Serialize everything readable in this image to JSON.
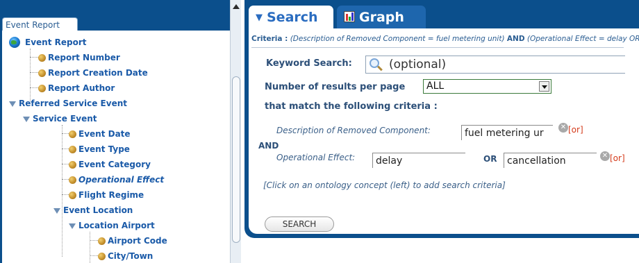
{
  "tree": {
    "tab_label": "Event Report",
    "items": [
      {
        "label": "Event Report",
        "type": "globe",
        "depth": 0
      },
      {
        "label": "Report Number",
        "type": "leaf",
        "depth": 1
      },
      {
        "label": "Report Creation Date",
        "type": "leaf",
        "depth": 1
      },
      {
        "label": "Report Author",
        "type": "leaf",
        "depth": 1
      },
      {
        "label": "Referred Service Event",
        "type": "branch",
        "depth": 0
      },
      {
        "label": "Service Event",
        "type": "branch",
        "depth": 1
      },
      {
        "label": "Event Date",
        "type": "leaf",
        "depth": 2
      },
      {
        "label": "Event Type",
        "type": "leaf",
        "depth": 2
      },
      {
        "label": "Event Category",
        "type": "leaf",
        "depth": 2
      },
      {
        "label": "Operational Effect",
        "type": "leaf",
        "depth": 2,
        "italic": true
      },
      {
        "label": "Flight Regime",
        "type": "leaf",
        "depth": 2
      },
      {
        "label": "Event Location",
        "type": "branch",
        "depth": 2
      },
      {
        "label": "Location Airport",
        "type": "branch",
        "depth": 3
      },
      {
        "label": "Airport Code",
        "type": "leaf",
        "depth": 4
      },
      {
        "label": "City/Town",
        "type": "leaf",
        "depth": 4
      }
    ]
  },
  "tabs": {
    "search": "Search",
    "graph": "Graph"
  },
  "criteria": {
    "label": "Criteria :",
    "text_1": "(Description of Removed Component = fuel metering unit)",
    "and": "AND",
    "text_2": "(Operational Effect = delay OR Operational Effect = cancellation)"
  },
  "form": {
    "keyword_label": "Keyword Search:",
    "keyword_placeholder": "(optional)",
    "results_label": "Number of results per page",
    "results_value": "ALL",
    "match_label": "that match the following criteria :",
    "removed_component_label": "Description of Removed Component:",
    "removed_component_value": "fuel metering ur",
    "or_link": "[or]",
    "and_label": "AND",
    "operational_effect_label": "Operational Effect:",
    "operational_effect_value": "delay",
    "or_label": "OR",
    "operational_effect_value_2": "cancellation",
    "hint": "[Click on an ontology concept (left) to add search criteria]",
    "search_button": "SEARCH"
  },
  "icons": {
    "clear": "x-circle-icon",
    "keyword": "magnifier-icon",
    "graph": "bar-chart-icon"
  },
  "colors": {
    "panel_blue": "#0b4f8c",
    "link_blue": "#1a5aa8",
    "or_red": "#d43a1a"
  }
}
